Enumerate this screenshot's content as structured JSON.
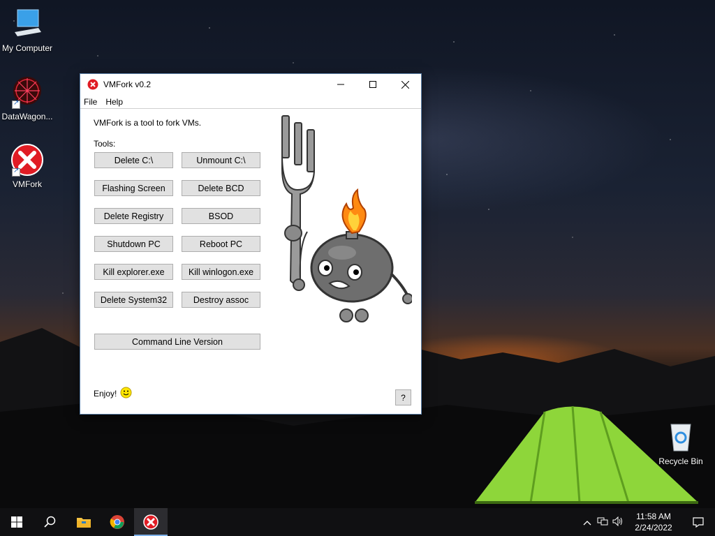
{
  "desktop": {
    "icons": [
      {
        "label": "My Computer"
      },
      {
        "label": "DataWagon..."
      },
      {
        "label": "VMFork"
      },
      {
        "label": "Recycle Bin"
      }
    ]
  },
  "window": {
    "title": "VMFork v0.2",
    "menu": [
      "File",
      "Help"
    ],
    "intro": "VMFork is a tool to fork VMs.",
    "tools_label": "Tools:",
    "buttons": [
      "Delete C:\\",
      "Unmount C:\\",
      "Flashing Screen",
      "Delete BCD",
      "Delete Registry",
      "BSOD",
      "Shutdown PC",
      "Reboot PC",
      "Kill explorer.exe",
      "Kill winlogon.exe",
      "Delete System32",
      "Destroy assoc"
    ],
    "command_line_button": "Command Line Version",
    "enjoy": "Enjoy!",
    "help_button": "?"
  },
  "taskbar": {
    "time": "11:58 AM",
    "date": "2/24/2022"
  },
  "icons": {
    "app": "red-x-icon",
    "start": "windows-start-icon",
    "search": "search-icon",
    "explorer": "folder-icon",
    "browser": "chrome-icon",
    "smiley": "smiley-icon"
  },
  "colors": {
    "accent": "#7fb2ea",
    "button_bg": "#e1e1e1",
    "app_red": "#e01c24",
    "taskbar": "#101012"
  }
}
